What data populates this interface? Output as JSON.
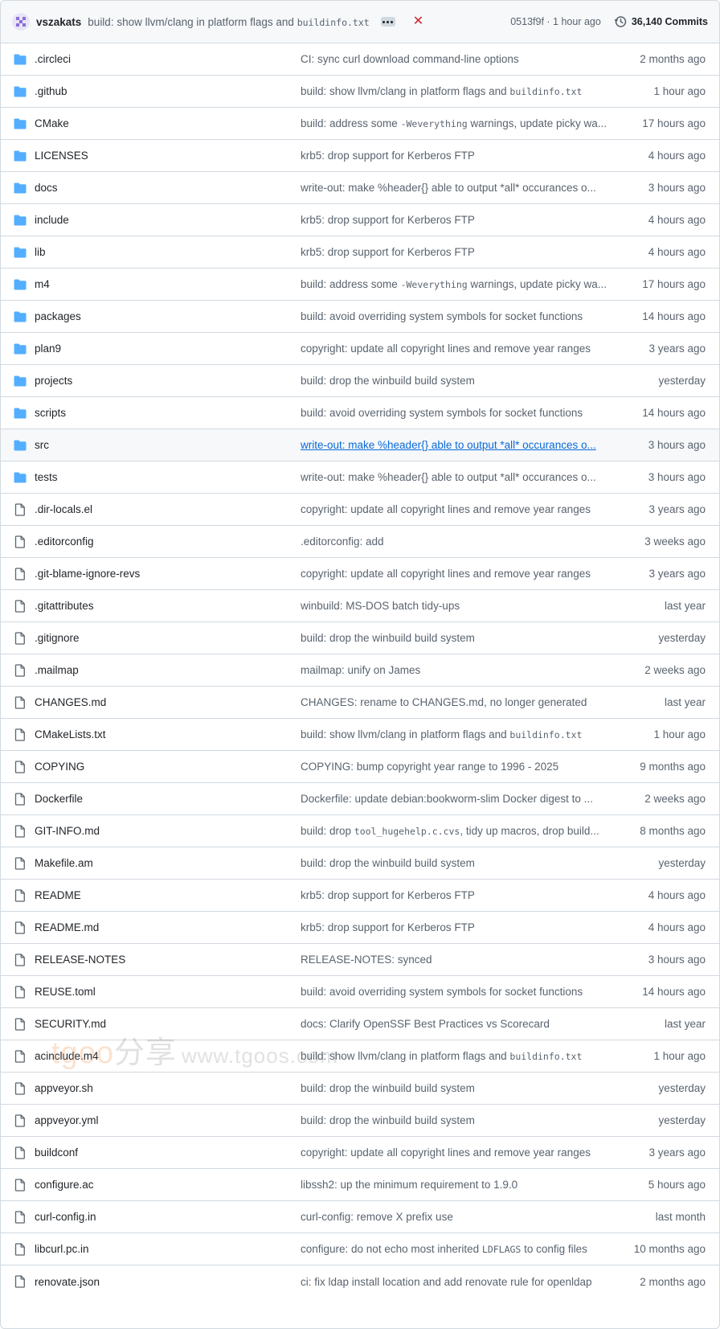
{
  "header": {
    "author": "vszakats",
    "message_prefix": "build: show llvm/clang in platform flags and ",
    "message_code": "buildinfo.txt",
    "status_icon": "x-mark-icon",
    "hash_time": "0513f9f · 1 hour ago",
    "commits_label": "36,140 Commits",
    "colors": {
      "status_fail": "#cf222e",
      "folder": "#54aeff",
      "link": "#0969da"
    }
  },
  "rows": [
    {
      "type": "folder",
      "name": ".circleci",
      "message": "CI: sync curl download command-line options",
      "age": "2 months ago"
    },
    {
      "type": "folder",
      "name": ".github",
      "message": "build: show llvm/clang in platform flags and ",
      "code": "buildinfo.txt",
      "age": "1 hour ago"
    },
    {
      "type": "folder",
      "name": "CMake",
      "message": "build: address some ",
      "code": "-Weverything",
      "message_tail": " warnings, update picky wa...",
      "age": "17 hours ago"
    },
    {
      "type": "folder",
      "name": "LICENSES",
      "message": "krb5: drop support for Kerberos FTP",
      "age": "4 hours ago"
    },
    {
      "type": "folder",
      "name": "docs",
      "message": "write-out: make %header{} able to output *all* occurances o...",
      "age": "3 hours ago"
    },
    {
      "type": "folder",
      "name": "include",
      "message": "krb5: drop support for Kerberos FTP",
      "age": "4 hours ago"
    },
    {
      "type": "folder",
      "name": "lib",
      "message": "krb5: drop support for Kerberos FTP",
      "age": "4 hours ago"
    },
    {
      "type": "folder",
      "name": "m4",
      "message": "build: address some ",
      "code": "-Weverything",
      "message_tail": " warnings, update picky wa...",
      "age": "17 hours ago"
    },
    {
      "type": "folder",
      "name": "packages",
      "message": "build: avoid overriding system symbols for socket functions",
      "age": "14 hours ago"
    },
    {
      "type": "folder",
      "name": "plan9",
      "message": "copyright: update all copyright lines and remove year ranges",
      "age": "3 years ago"
    },
    {
      "type": "folder",
      "name": "projects",
      "message": "build: drop the winbuild build system",
      "age": "yesterday"
    },
    {
      "type": "folder",
      "name": "scripts",
      "message": "build: avoid overriding system symbols for socket functions",
      "age": "14 hours ago"
    },
    {
      "type": "folder",
      "name": "src",
      "message": "write-out: make %header{} able to output *all* occurances o...",
      "age": "3 hours ago",
      "hover": true
    },
    {
      "type": "folder",
      "name": "tests",
      "message": "write-out: make %header{} able to output *all* occurances o...",
      "age": "3 hours ago"
    },
    {
      "type": "file",
      "name": ".dir-locals.el",
      "message": "copyright: update all copyright lines and remove year ranges",
      "age": "3 years ago"
    },
    {
      "type": "file",
      "name": ".editorconfig",
      "message": ".editorconfig: add",
      "age": "3 weeks ago"
    },
    {
      "type": "file",
      "name": ".git-blame-ignore-revs",
      "message": "copyright: update all copyright lines and remove year ranges",
      "age": "3 years ago"
    },
    {
      "type": "file",
      "name": ".gitattributes",
      "message": "winbuild: MS-DOS batch tidy-ups",
      "age": "last year"
    },
    {
      "type": "file",
      "name": ".gitignore",
      "message": "build: drop the winbuild build system",
      "age": "yesterday"
    },
    {
      "type": "file",
      "name": ".mailmap",
      "message": "mailmap: unify on James",
      "age": "2 weeks ago"
    },
    {
      "type": "file",
      "name": "CHANGES.md",
      "message": "CHANGES: rename to CHANGES.md, no longer generated",
      "age": "last year"
    },
    {
      "type": "file",
      "name": "CMakeLists.txt",
      "message": "build: show llvm/clang in platform flags and ",
      "code": "buildinfo.txt",
      "age": "1 hour ago"
    },
    {
      "type": "file",
      "name": "COPYING",
      "message": "COPYING: bump copyright year range to 1996 - 2025",
      "age": "9 months ago"
    },
    {
      "type": "file",
      "name": "Dockerfile",
      "message": "Dockerfile: update debian:bookworm-slim Docker digest to ...",
      "age": "2 weeks ago"
    },
    {
      "type": "file",
      "name": "GIT-INFO.md",
      "message": "build: drop ",
      "code": "tool_hugehelp.c.cvs",
      "message_tail": ", tidy up macros, drop build...",
      "age": "8 months ago"
    },
    {
      "type": "file",
      "name": "Makefile.am",
      "message": "build: drop the winbuild build system",
      "age": "yesterday"
    },
    {
      "type": "file",
      "name": "README",
      "message": "krb5: drop support for Kerberos FTP",
      "age": "4 hours ago"
    },
    {
      "type": "file",
      "name": "README.md",
      "message": "krb5: drop support for Kerberos FTP",
      "age": "4 hours ago"
    },
    {
      "type": "file",
      "name": "RELEASE-NOTES",
      "message": "RELEASE-NOTES: synced",
      "age": "3 hours ago"
    },
    {
      "type": "file",
      "name": "REUSE.toml",
      "message": "build: avoid overriding system symbols for socket functions",
      "age": "14 hours ago"
    },
    {
      "type": "file",
      "name": "SECURITY.md",
      "message": "docs: Clarify OpenSSF Best Practices vs Scorecard",
      "age": "last year"
    },
    {
      "type": "file",
      "name": "acinclude.m4",
      "message": "build: show llvm/clang in platform flags and ",
      "code": "buildinfo.txt",
      "age": "1 hour ago"
    },
    {
      "type": "file",
      "name": "appveyor.sh",
      "message": "build: drop the winbuild build system",
      "age": "yesterday"
    },
    {
      "type": "file",
      "name": "appveyor.yml",
      "message": "build: drop the winbuild build system",
      "age": "yesterday"
    },
    {
      "type": "file",
      "name": "buildconf",
      "message": "copyright: update all copyright lines and remove year ranges",
      "age": "3 years ago"
    },
    {
      "type": "file",
      "name": "configure.ac",
      "message": "libssh2: up the minimum requirement to 1.9.0",
      "age": "5 hours ago"
    },
    {
      "type": "file",
      "name": "curl-config.in",
      "message": "curl-config: remove X prefix use",
      "age": "last month"
    },
    {
      "type": "file",
      "name": "libcurl.pc.in",
      "message": "configure: do not echo most inherited ",
      "code": "LDFLAGS",
      "message_tail": " to config files",
      "age": "10 months ago"
    },
    {
      "type": "file",
      "name": "renovate.json",
      "message": "ci: fix ldap install location and add renovate rule for openldap",
      "age": "2 months ago"
    }
  ],
  "watermark": {
    "brand": "tgoo",
    "cn": "分享",
    "site": "www.tgoos.com"
  }
}
